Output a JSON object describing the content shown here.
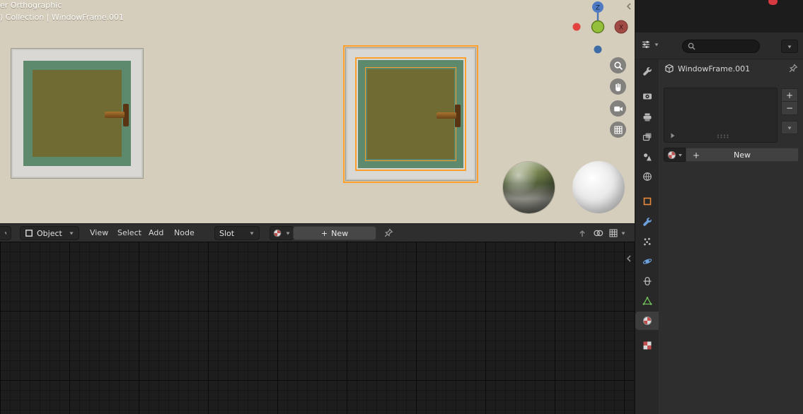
{
  "viewport": {
    "view_label": "er Orthographic",
    "context_label": ") Collection | WindowFrame.001",
    "gizmo": {
      "z_label": "Z",
      "x_label": "X"
    }
  },
  "shader_header": {
    "mode": "Object",
    "menus": [
      "View",
      "Select",
      "Add",
      "Node"
    ],
    "slot": "Slot",
    "plus": "+",
    "new_button": "New"
  },
  "properties": {
    "search_placeholder": "",
    "breadcrumb": "WindowFrame.001",
    "plus": "+",
    "minus": "−",
    "new_button": "New",
    "tabs": [
      "tool",
      "render",
      "output",
      "view-layer",
      "scene",
      "world",
      "object",
      "modifiers",
      "particles",
      "physics",
      "constraints",
      "object-data",
      "material",
      "texture"
    ],
    "active_tab": "material"
  },
  "colors": {
    "viewport_bg": "#d6cebc",
    "selection_outline": "#ff9f2e",
    "frame_gray": "#d9d8d4",
    "frame_teal": "#5d8a6d",
    "glass_olive": "#6f6b33",
    "node_editor_bg": "#1d1d1d",
    "panel_bg": "#2e2e2e",
    "accent_object_orange": "#e8893b",
    "accent_modifier_blue": "#6ca0dd",
    "accent_data_green": "#71c15c",
    "accent_material_red": "#c0504d"
  }
}
